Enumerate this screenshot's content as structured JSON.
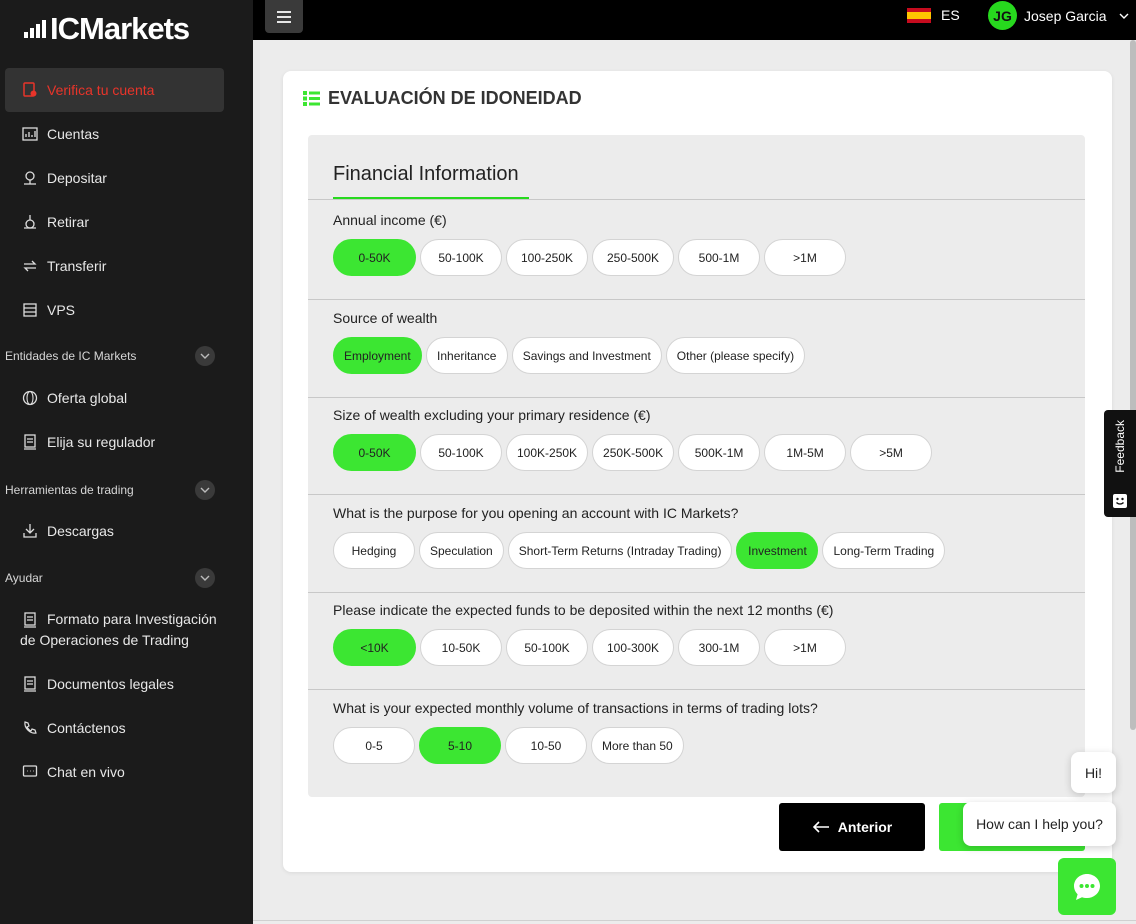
{
  "brand": {
    "logo_text": "ICMarkets",
    "accent": "#3ce632",
    "alert": "#e8342a"
  },
  "topbar": {
    "language": "ES",
    "user_initials": "JG",
    "user_name": "Josep Garcia"
  },
  "sidebar": {
    "verify": "Verifica tu cuenta",
    "accounts": "Cuentas",
    "deposit": "Depositar",
    "withdraw": "Retirar",
    "transfer": "Transferir",
    "vps": "VPS",
    "entities_head": "Entidades de IC Markets",
    "global_offer": "Oferta global",
    "choose_regulator": "Elija su regulador",
    "tools_head": "Herramientas de trading",
    "downloads": "Descargas",
    "help_head": "Ayudar",
    "investigation_form": "Formato para Investigación de Operaciones de Trading",
    "legal_docs": "Documentos legales",
    "contact": "Contáctenos",
    "live_chat": "Chat en vivo"
  },
  "page": {
    "title": "EVALUACIÓN DE IDONEIDAD",
    "section_title": "Financial Information",
    "questions": [
      {
        "label": "Annual income (€)",
        "options": [
          "0-50K",
          "50-100K",
          "100-250K",
          "250-500K",
          "500-1M",
          ">1M"
        ],
        "selected": "0-50K"
      },
      {
        "label": "Source of wealth",
        "options": [
          "Employment",
          "Inheritance",
          "Savings and Investment",
          "Other (please specify)"
        ],
        "selected": "Employment"
      },
      {
        "label": "Size of wealth excluding your primary residence (€)",
        "options": [
          "0-50K",
          "50-100K",
          "100K-250K",
          "250K-500K",
          "500K-1M",
          "1M-5M",
          ">5M"
        ],
        "selected": "0-50K"
      },
      {
        "label": "What is the purpose for you opening an account with IC Markets?",
        "options": [
          "Hedging",
          "Speculation",
          "Short-Term Returns (Intraday Trading)",
          "Investment",
          "Long-Term Trading"
        ],
        "selected": "Investment"
      },
      {
        "label": "Please indicate the expected funds to be deposited within the next 12 months (€)",
        "options": [
          "<10K",
          "10-50K",
          "50-100K",
          "100-300K",
          "300-1M",
          ">1M"
        ],
        "selected": "<10K"
      },
      {
        "label": "What is your expected monthly volume of transactions in terms of trading lots?",
        "options": [
          "0-5",
          "5-10",
          "10-50",
          "More than 50"
        ],
        "selected": "5-10"
      }
    ],
    "prev_button": "Anterior"
  },
  "feedback_label": "Feedback",
  "chat": {
    "greeting": "Hi!",
    "prompt": "How can I help you?"
  }
}
